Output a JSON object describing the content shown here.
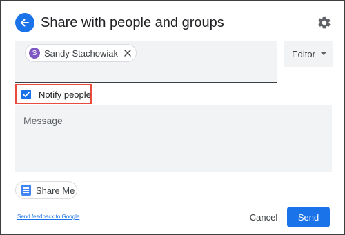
{
  "dialog": {
    "title": "Share with people and groups"
  },
  "recipients": [
    {
      "initial": "S",
      "name": "Sandy Stachowiak"
    }
  ],
  "role": {
    "selected": "Editor"
  },
  "notify": {
    "label": "Notify people",
    "checked": true
  },
  "message": {
    "placeholder": "Message"
  },
  "share_me": {
    "label": "Share Me"
  },
  "footer": {
    "feedback_link": "Send feedback to Google",
    "cancel_label": "Cancel",
    "send_label": "Send"
  },
  "colors": {
    "accent": "#1a73e8",
    "highlight_border": "#e94b3c",
    "avatar": "#7e57c2",
    "field_background": "#f1f3f4"
  },
  "icons": [
    "back-arrow-icon",
    "gear-icon",
    "close-icon",
    "chevron-down-icon",
    "checkmark-icon",
    "document-icon"
  ]
}
